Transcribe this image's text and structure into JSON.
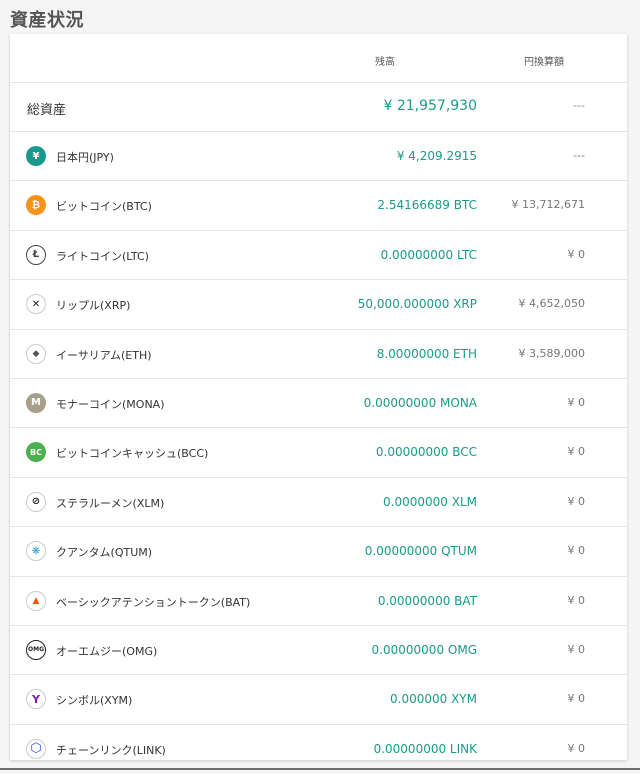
{
  "title": "資産状況",
  "header": {
    "balance": "残高",
    "jpy_value": "円換算額"
  },
  "total": {
    "label": "総資産",
    "amount": "¥ 21,957,930",
    "jpy": "---"
  },
  "assets": [
    {
      "name": "日本円(JPY)",
      "balance": "¥ 4,209.2915",
      "jpy": "---",
      "icon": "yen-icon",
      "icon_color": "#1a9a8a",
      "glyph": "¥"
    },
    {
      "name": "ビットコイン(BTC)",
      "balance": "2.54166689 BTC",
      "jpy": "¥ 13,712,671",
      "icon": "bitcoin-icon",
      "icon_color": "#f7931a",
      "glyph": "₿"
    },
    {
      "name": "ライトコイン(LTC)",
      "balance": "0.00000000 LTC",
      "jpy": "¥ 0",
      "icon": "litecoin-icon",
      "icon_color": "#ffffff",
      "glyph": "Ł"
    },
    {
      "name": "リップル(XRP)",
      "balance": "50,000.000000 XRP",
      "jpy": "¥ 4,652,050",
      "icon": "ripple-icon",
      "icon_color": "#ffffff",
      "glyph": "✕"
    },
    {
      "name": "イーサリアム(ETH)",
      "balance": "8.00000000 ETH",
      "jpy": "¥ 3,589,000",
      "icon": "ethereum-icon",
      "icon_color": "#ffffff",
      "glyph": "◆"
    },
    {
      "name": "モナーコイン(MONA)",
      "balance": "0.00000000 MONA",
      "jpy": "¥ 0",
      "icon": "monacoin-icon",
      "icon_color": "#a89f8a",
      "glyph": "M"
    },
    {
      "name": "ビットコインキャッシュ(BCC)",
      "balance": "0.00000000 BCC",
      "jpy": "¥ 0",
      "icon": "bitcoin-cash-icon",
      "icon_color": "#4cb050",
      "glyph": "BC"
    },
    {
      "name": "ステラルーメン(XLM)",
      "balance": "0.0000000 XLM",
      "jpy": "¥ 0",
      "icon": "stellar-icon",
      "icon_color": "#ffffff",
      "glyph": "⊘"
    },
    {
      "name": "クアンタム(QTUM)",
      "balance": "0.00000000 QTUM",
      "jpy": "¥ 0",
      "icon": "qtum-icon",
      "icon_color": "#ffffff",
      "glyph": "❋"
    },
    {
      "name": "ベーシックアテンショントークン(BAT)",
      "balance": "0.00000000 BAT",
      "jpy": "¥ 0",
      "icon": "bat-icon",
      "icon_color": "#ffffff",
      "glyph": "▲"
    },
    {
      "name": "オーエムジー(OMG)",
      "balance": "0.00000000 OMG",
      "jpy": "¥ 0",
      "icon": "omg-icon",
      "icon_color": "#ffffff",
      "glyph": "OMG"
    },
    {
      "name": "シンボル(XYM)",
      "balance": "0.000000 XYM",
      "jpy": "¥ 0",
      "icon": "symbol-icon",
      "icon_color": "#ffffff",
      "glyph": "Y"
    },
    {
      "name": "チェーンリンク(LINK)",
      "balance": "0.00000000 LINK",
      "jpy": "¥ 0",
      "icon": "chainlink-icon",
      "icon_color": "#ffffff",
      "glyph": "⬡"
    }
  ]
}
